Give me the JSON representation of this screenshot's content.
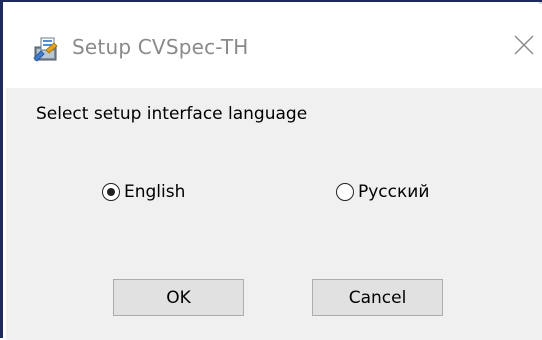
{
  "window": {
    "title": "Setup CVSpec-TH",
    "icon": "setup-installer-icon",
    "close_icon": "close-x-icon"
  },
  "dialog": {
    "prompt": "Select setup interface language",
    "options": [
      {
        "label": "English",
        "selected": true
      },
      {
        "label": "Русский",
        "selected": false
      }
    ],
    "buttons": {
      "ok": "OK",
      "cancel": "Cancel"
    }
  },
  "colors": {
    "title_text": "#8a8a8a",
    "client_background": "#f0f0f0",
    "button_face": "#e1e1e1",
    "button_border": "#adadad",
    "window_border": "#1e2a5c"
  }
}
